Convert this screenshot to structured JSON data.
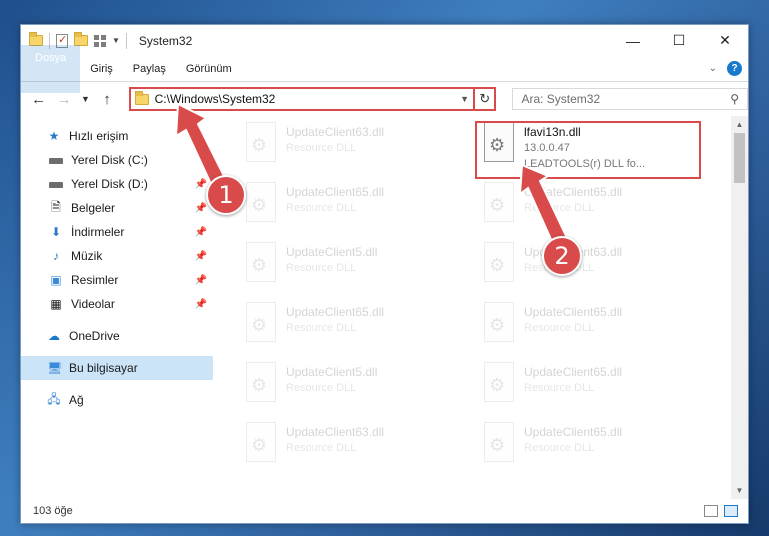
{
  "window": {
    "title": "System32",
    "controls": {
      "minimize": "—",
      "maximize": "☐",
      "close": "✕"
    }
  },
  "ribbon": {
    "tabs": [
      "Dosya",
      "Giriş",
      "Paylaş",
      "Görünüm"
    ],
    "help": "?"
  },
  "address": {
    "path": "C:\\Windows\\System32",
    "search_placeholder": "Ara: System32"
  },
  "nav": {
    "items": [
      {
        "label": "Hızlı erişim",
        "icon": "star-icon"
      },
      {
        "label": "Yerel Disk (C:)",
        "icon": "disk-icon"
      },
      {
        "label": "Yerel Disk (D:)",
        "icon": "disk-icon"
      },
      {
        "label": "Belgeler",
        "icon": "documents-icon"
      },
      {
        "label": "İndirmeler",
        "icon": "download-icon"
      },
      {
        "label": "Müzik",
        "icon": "music-icon"
      },
      {
        "label": "Resimler",
        "icon": "pictures-icon"
      },
      {
        "label": "Videolar",
        "icon": "video-icon"
      },
      {
        "label": "OneDrive",
        "icon": "cloud-icon"
      },
      {
        "label": "Bu bilgisayar",
        "icon": "computer-icon"
      },
      {
        "label": "Ağ",
        "icon": "network-icon"
      }
    ]
  },
  "files": [
    {
      "name": "UpdateClient63.dll",
      "sub": "Resource DLL",
      "sub2": ""
    },
    {
      "name": "lfavi13n.dll",
      "sub": "13.0.0.47",
      "sub2": "LEADTOOLS(r) DLL fo..."
    },
    {
      "name": "UpdateClient65.dll",
      "sub": "Resource DLL",
      "sub2": ""
    },
    {
      "name": "UpdateClient65.dll",
      "sub": "Resource DLL",
      "sub2": ""
    },
    {
      "name": "UpdateClient5.dll",
      "sub": "Resource DLL",
      "sub2": ""
    },
    {
      "name": "UpdateClient63.dll",
      "sub": "Resource DLL",
      "sub2": ""
    },
    {
      "name": "UpdateClient65.dll",
      "sub": "Resource DLL",
      "sub2": ""
    },
    {
      "name": "UpdateClient65.dll",
      "sub": "Resource DLL",
      "sub2": ""
    },
    {
      "name": "UpdateClient5.dll",
      "sub": "Resource DLL",
      "sub2": ""
    },
    {
      "name": "UpdateClient65.dll",
      "sub": "Resource DLL",
      "sub2": ""
    },
    {
      "name": "UpdateClient63.dll",
      "sub": "Resource DLL",
      "sub2": ""
    },
    {
      "name": "UpdateClient65.dll",
      "sub": "Resource DLL",
      "sub2": ""
    }
  ],
  "status": {
    "count": "103 öğe"
  },
  "callouts": {
    "one": "1",
    "two": "2"
  },
  "colors": {
    "accent": "#1979ca",
    "highlight": "#d94b4b"
  }
}
